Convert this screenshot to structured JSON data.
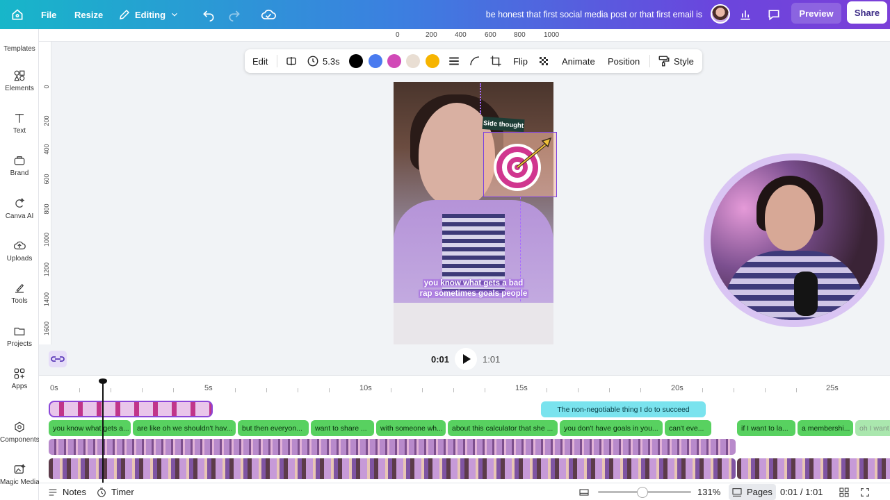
{
  "topbar": {
    "file_label": "File",
    "resize_label": "Resize",
    "mode_label": "Editing",
    "doc_title": "be honest that first social media post or that first email is",
    "preview_label": "Preview",
    "share_label": "Share"
  },
  "sidebar": {
    "items": [
      {
        "label": "Templates"
      },
      {
        "label": "Elements"
      },
      {
        "label": "Text"
      },
      {
        "label": "Brand"
      },
      {
        "label": "Canva AI"
      },
      {
        "label": "Uploads"
      },
      {
        "label": "Tools"
      },
      {
        "label": "Projects"
      },
      {
        "label": "Apps"
      },
      {
        "label": "Components"
      },
      {
        "label": "Magic Media"
      }
    ]
  },
  "ruler": {
    "top_ticks": [
      "0",
      "200",
      "400",
      "600",
      "800",
      "1000"
    ],
    "left_ticks": [
      "0",
      "200",
      "400",
      "600",
      "800",
      "1000",
      "1200",
      "1400",
      "1600"
    ]
  },
  "toolbar": {
    "edit_label": "Edit",
    "duration_label": "5.3s",
    "flip_label": "Flip",
    "animate_label": "Animate",
    "position_label": "Position",
    "style_label": "Style",
    "swatches": [
      "#000000",
      "#4a7bef",
      "#d14ab7",
      "#e9ded3",
      "#f6b400"
    ]
  },
  "canvas": {
    "caption_line1": "you know what gets a bad",
    "caption_line2": "rap sometimes goals people",
    "side_label": "Side thought"
  },
  "playback": {
    "current_time": "0:01",
    "total_time": "1:01"
  },
  "timeline": {
    "ticks": [
      "0s",
      "5s",
      "10s",
      "15s",
      "20s",
      "25s"
    ],
    "teal_clip": "The non-negotiable thing I do to succeed",
    "caption_clips": [
      "you know what gets a...",
      "are like oh we shouldn't hav...",
      "but then everyon...",
      "want to share ...",
      "with someone wh...",
      "about this calculator that she ...",
      "you don't have goals in you...",
      "can't eve...",
      "if I want to la...",
      "a membershi...",
      "oh I want"
    ]
  },
  "bottombar": {
    "notes_label": "Notes",
    "timer_label": "Timer",
    "zoom_label": "131%",
    "pages_label": "Pages",
    "page_time": "0:01 / 1:01",
    "zoom_level": 0.48
  }
}
